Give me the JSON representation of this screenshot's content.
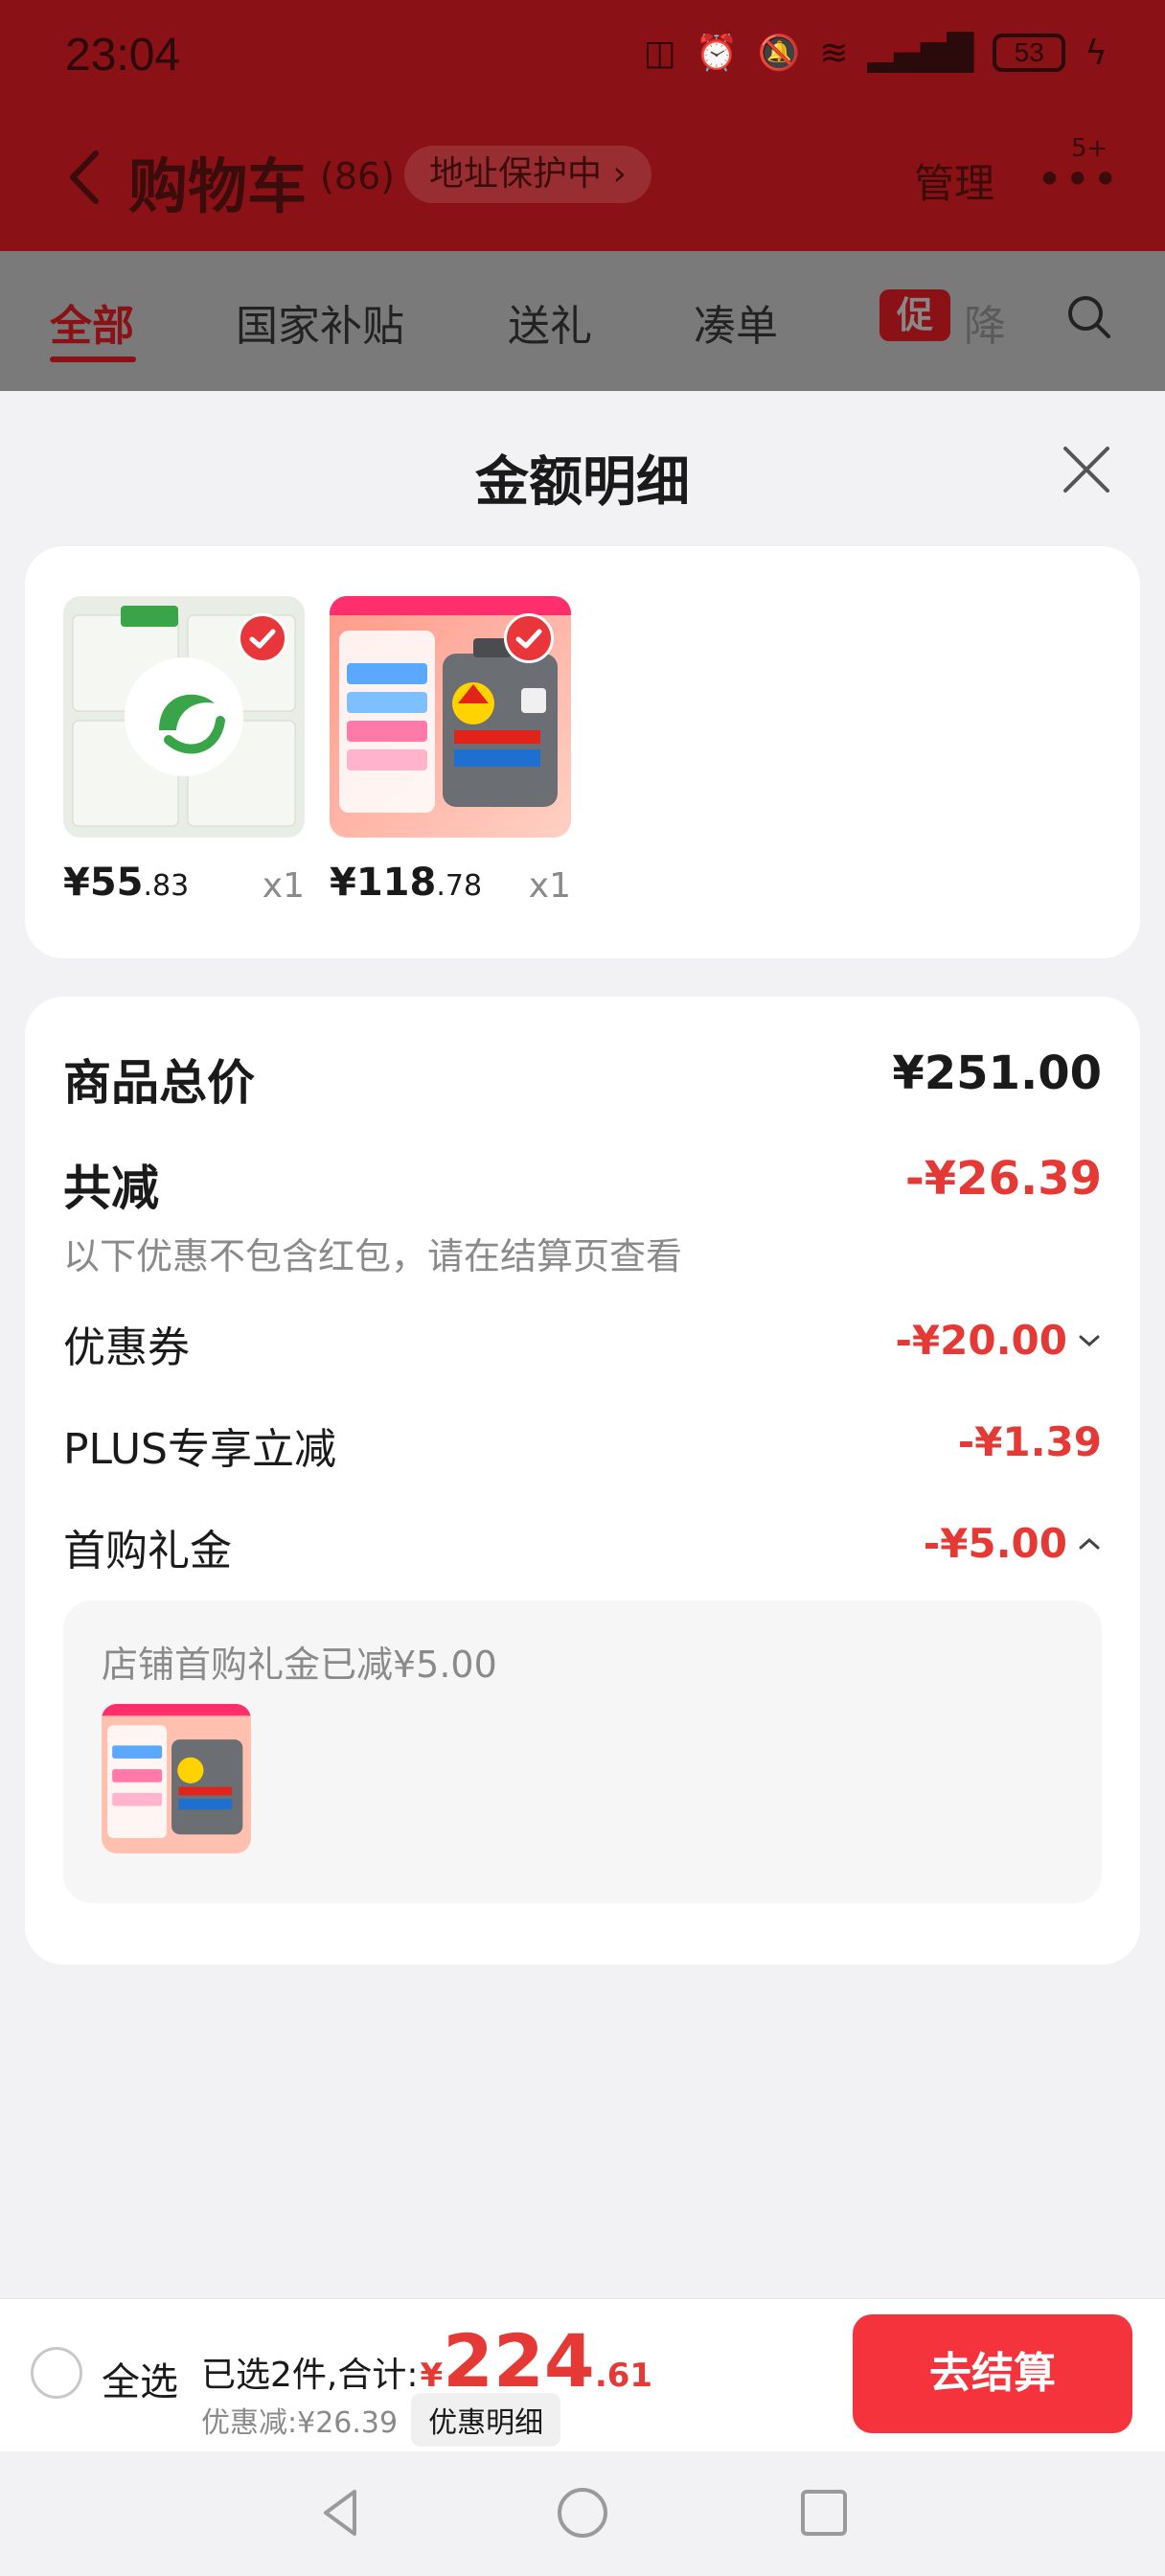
{
  "status_bar": {
    "time": "23:04",
    "battery": "53"
  },
  "header": {
    "title": "购物车",
    "count": "(86)",
    "address_pill": "地址保护中",
    "manage": "管理",
    "more_badge": "5+"
  },
  "tabs": [
    {
      "label": "全部"
    },
    {
      "label": "国家补贴"
    },
    {
      "label": "送礼"
    },
    {
      "label": "凑单"
    }
  ],
  "promo_tab": {
    "tag": "促",
    "label": "降"
  },
  "sheet": {
    "title": "金额明细",
    "products": [
      {
        "price_yen": "¥",
        "price_int": "55",
        "price_cents": ".83",
        "qty": "x1"
      },
      {
        "price_yen": "¥",
        "price_int": "118",
        "price_cents": ".78",
        "qty": "x1"
      }
    ],
    "total_price": {
      "label": "商品总价",
      "value": "¥251.00"
    },
    "total_discount": {
      "label": "共减",
      "value": "-¥26.39",
      "note": "以下优惠不包含红包，请在结算页查看"
    },
    "items": [
      {
        "label": "优惠券",
        "value": "-¥20.00"
      },
      {
        "label": "PLUS专享立减",
        "value": "-¥1.39"
      },
      {
        "label": "首购礼金",
        "value": "-¥5.00"
      }
    ],
    "first_purchase_note": "店铺首购礼金已减¥5.00"
  },
  "bottom_bar": {
    "select_all": "全选",
    "summary_prefix": "已选2件,合计:",
    "total_yen": "¥",
    "total_int": "224",
    "total_cents": ".61",
    "discount_text": "优惠减:¥26.39",
    "detail_chip": "优惠明细",
    "checkout": "去结算"
  },
  "colors": {
    "accent": "#e53935",
    "checkout": "#f4333c",
    "header_bg": "#8a1116"
  }
}
